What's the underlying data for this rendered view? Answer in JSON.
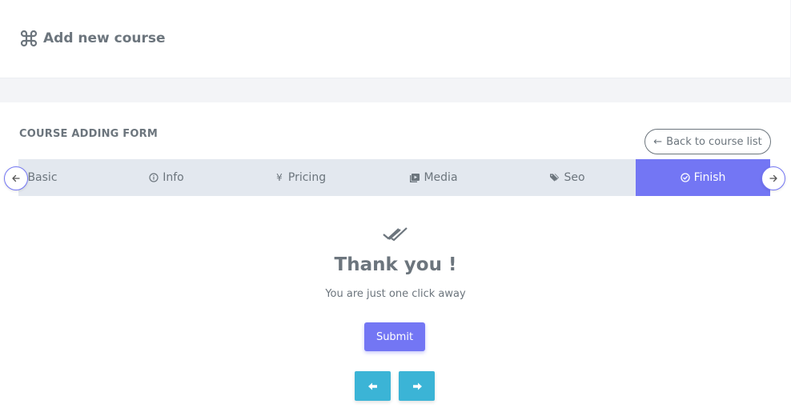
{
  "header": {
    "title": "Add new course",
    "icon": "command-icon"
  },
  "form": {
    "title": "COURSE ADDING FORM",
    "back_button": "Back to course list"
  },
  "tabs": [
    {
      "label": "Basic",
      "icon": "none"
    },
    {
      "label": "Info",
      "icon": "info-circle-icon"
    },
    {
      "label": "Pricing",
      "icon": "yen-icon"
    },
    {
      "label": "Media",
      "icon": "play-media-icon"
    },
    {
      "label": "Seo",
      "icon": "tags-icon"
    },
    {
      "label": "Finish",
      "icon": "check-circle-icon",
      "active": true
    }
  ],
  "finish": {
    "heading": "Thank you !",
    "message": "You are just one click away",
    "submit_label": "Submit"
  },
  "colors": {
    "accent": "#7376f4",
    "step_buttons": "#3bb4d6",
    "tabs_bg": "#e3e8ef",
    "text": "#6c757d"
  }
}
